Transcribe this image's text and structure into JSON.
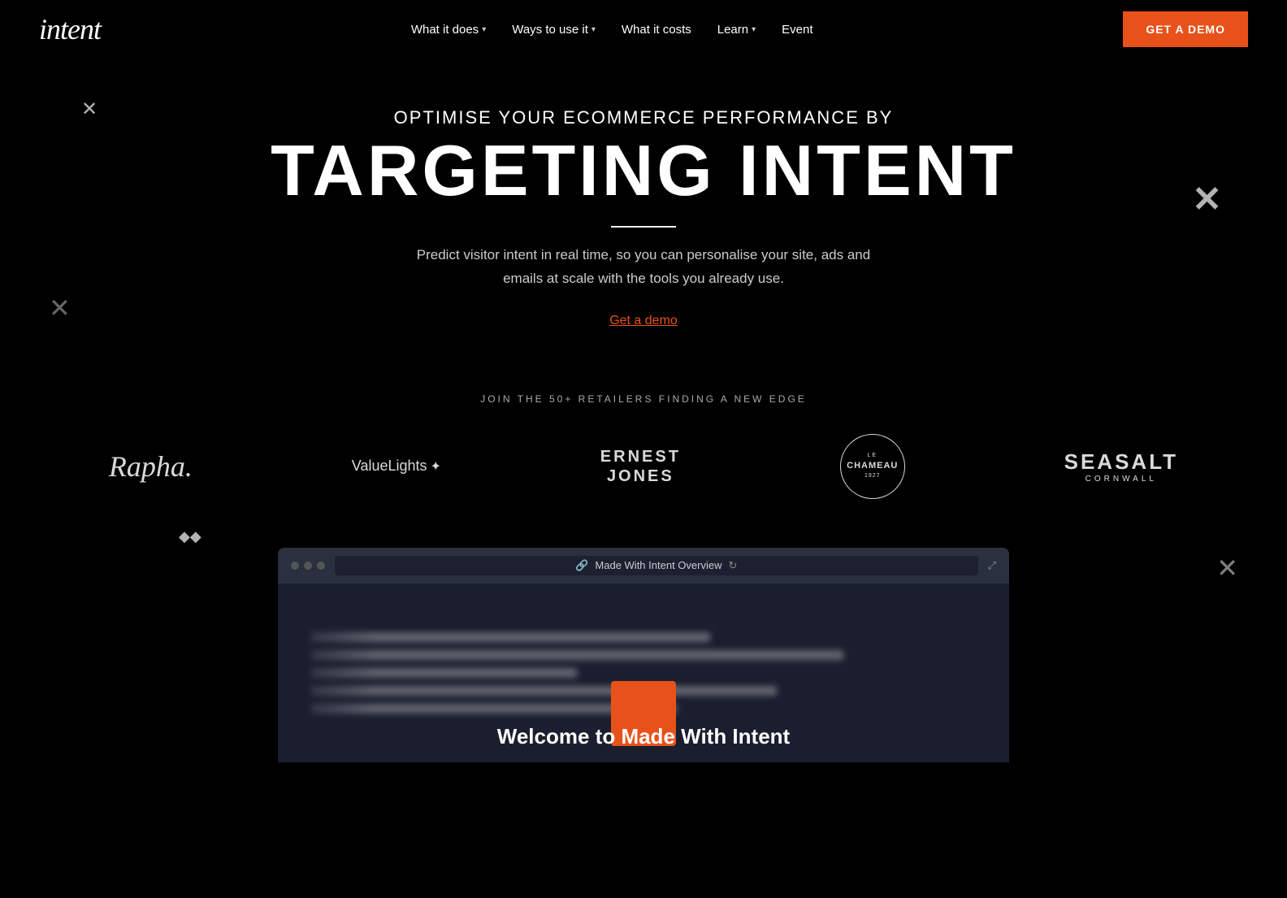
{
  "brand": {
    "logo": "intent",
    "tagline": "OPTIMISE YOUR ECOMMERCE PERFORMANCE BY",
    "title": "TARGETING INTENT",
    "description": "Predict visitor intent in real time, so you can personalise your site, ads and emails at scale with the tools you already use.",
    "cta_link": "Get a demo",
    "logos_heading": "JOIN THE 50+ RETAILERS FINDING A NEW EDGE"
  },
  "nav": {
    "links": [
      {
        "label": "What it does",
        "has_dropdown": true
      },
      {
        "label": "Ways to use it",
        "has_dropdown": true
      },
      {
        "label": "What it costs",
        "has_dropdown": false
      },
      {
        "label": "Learn",
        "has_dropdown": true
      },
      {
        "label": "Event",
        "has_dropdown": false
      }
    ],
    "cta": "GET A DEMO"
  },
  "logos": [
    {
      "name": "Rapha",
      "style": "rapha"
    },
    {
      "name": "ValueLights",
      "style": "valuelights"
    },
    {
      "name": "ERNEST JONES",
      "style": "ernest"
    },
    {
      "name": "LE CHAMEAU",
      "style": "chameau"
    },
    {
      "name": "SEASALT CORNWALL",
      "style": "seasalt"
    }
  ],
  "video_section": {
    "browser_url": "Made With Intent Overview",
    "welcome_text": "Welcome to Made With Intent"
  },
  "decorators": {
    "x_topleft": "✕",
    "x_midleft": "✕",
    "x_topright": "✕",
    "x_bottomright": "✕",
    "x_bottomleft2": "◆◆"
  }
}
